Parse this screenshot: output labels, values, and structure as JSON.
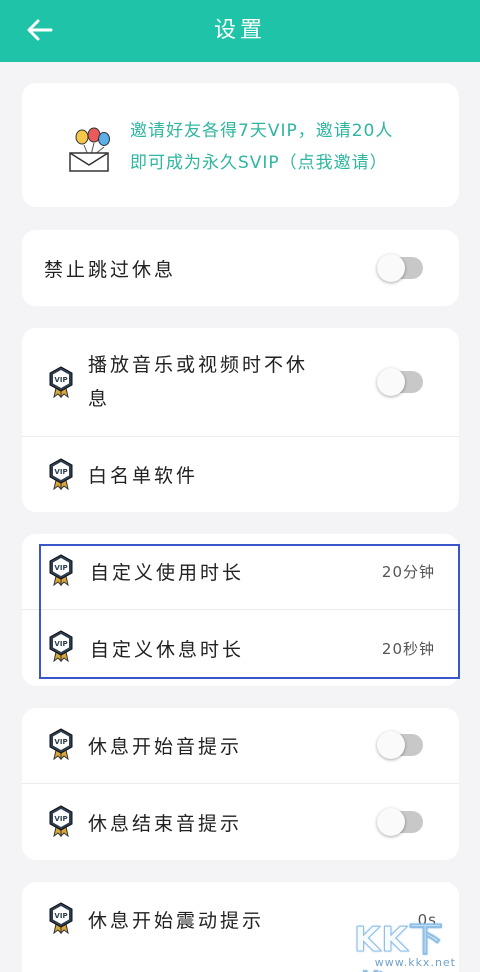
{
  "header": {
    "title": "设置",
    "accent_color": "#1fc4a8"
  },
  "invite": {
    "line1": "邀请好友各得7天VIP，邀请20人",
    "line2": "即可成为永久SVIP（点我邀请）",
    "text_color": "#2fb6a0",
    "icon": "envelope-balloons-icon"
  },
  "settings": {
    "no_skip_rest": {
      "label": "禁止跳过休息",
      "enabled": false
    },
    "no_rest_media_line1": "播放音乐或视频时不休",
    "no_rest_media_line2": "息",
    "no_rest_media_enabled": false,
    "whitelist": {
      "label": "白名单软件"
    },
    "custom_use": {
      "label": "自定义使用时长",
      "value": "20分钟"
    },
    "custom_rest": {
      "label": "自定义休息时长",
      "value": "20秒钟"
    },
    "rest_start_sound": {
      "label": "休息开始音提示",
      "enabled": false
    },
    "rest_end_sound": {
      "label": "休息结束音提示",
      "enabled": false
    },
    "rest_start_vibrate": {
      "label": "休息开始震动提示",
      "value": "0s"
    }
  },
  "vip_badge": {
    "text": "VIP",
    "icon": "vip-badge-icon"
  },
  "highlight_color": "#3a56c8",
  "watermark": {
    "main": "KK下载",
    "sub": "www.kkx.net"
  }
}
